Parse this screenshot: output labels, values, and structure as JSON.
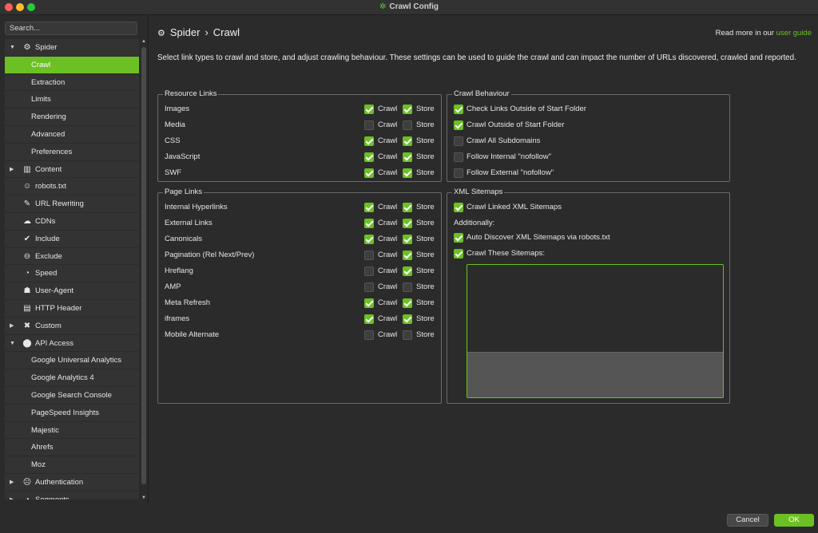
{
  "window": {
    "title": "Crawl Config",
    "logo_icon": "spider-web-icon"
  },
  "sidebar": {
    "search_placeholder": "Search...",
    "items": [
      {
        "label": "Spider",
        "icon": "⚙",
        "expanded": true,
        "level": "top"
      },
      {
        "label": "Crawl",
        "level": "child",
        "active": true
      },
      {
        "label": "Extraction",
        "level": "child"
      },
      {
        "label": "Limits",
        "level": "child"
      },
      {
        "label": "Rendering",
        "level": "child"
      },
      {
        "label": "Advanced",
        "level": "child"
      },
      {
        "label": "Preferences",
        "level": "child"
      },
      {
        "label": "Content",
        "icon": "▥",
        "expanded": false,
        "level": "top"
      },
      {
        "label": "robots.txt",
        "icon": "☺",
        "level": "top"
      },
      {
        "label": "URL Rewriting",
        "icon": "✎",
        "level": "top"
      },
      {
        "label": "CDNs",
        "icon": "☁",
        "level": "top"
      },
      {
        "label": "Include",
        "icon": "✔",
        "level": "top"
      },
      {
        "label": "Exclude",
        "icon": "⊖",
        "level": "top"
      },
      {
        "label": "Speed",
        "icon": "◔",
        "level": "top"
      },
      {
        "label": "User-Agent",
        "icon": "☗",
        "level": "top"
      },
      {
        "label": "HTTP Header",
        "icon": "▤",
        "level": "top"
      },
      {
        "label": "Custom",
        "icon": "✖",
        "expanded": false,
        "level": "top"
      },
      {
        "label": "API Access",
        "icon": "⬤",
        "expanded": true,
        "level": "top"
      },
      {
        "label": "Google Universal Analytics",
        "level": "child"
      },
      {
        "label": "Google Analytics 4",
        "level": "child"
      },
      {
        "label": "Google Search Console",
        "level": "child"
      },
      {
        "label": "PageSpeed Insights",
        "level": "child"
      },
      {
        "label": "Majestic",
        "level": "child"
      },
      {
        "label": "Ahrefs",
        "level": "child"
      },
      {
        "label": "Moz",
        "level": "child"
      },
      {
        "label": "Authentication",
        "icon": "☹",
        "expanded": false,
        "level": "top"
      },
      {
        "label": "Segments",
        "icon": "◕",
        "expanded": false,
        "level": "top"
      }
    ]
  },
  "header": {
    "breadcrumb_root": "Spider",
    "breadcrumb_separator": "›",
    "breadcrumb_current": "Crawl",
    "readmore_prefix": "Read more in our",
    "readmore_link": "user guide"
  },
  "description": "Select link types to crawl and store, and adjust crawling behaviour. These settings can be used to guide the crawl and can impact the number of URLs discovered, crawled and reported.",
  "crawl_label": "Crawl",
  "store_label": "Store",
  "resource_links": {
    "title": "Resource Links",
    "rows": [
      {
        "label": "Images",
        "crawl": true,
        "store": true
      },
      {
        "label": "Media",
        "crawl": false,
        "store": false
      },
      {
        "label": "CSS",
        "crawl": true,
        "store": true
      },
      {
        "label": "JavaScript",
        "crawl": true,
        "store": true
      },
      {
        "label": "SWF",
        "crawl": true,
        "store": true
      }
    ]
  },
  "page_links": {
    "title": "Page Links",
    "rows": [
      {
        "label": "Internal Hyperlinks",
        "crawl": true,
        "store": true
      },
      {
        "label": "External Links",
        "crawl": true,
        "store": true
      },
      {
        "label": "Canonicals",
        "crawl": true,
        "store": true
      },
      {
        "label": "Pagination (Rel Next/Prev)",
        "crawl": false,
        "store": true
      },
      {
        "label": "Hreflang",
        "crawl": false,
        "store": true
      },
      {
        "label": "AMP",
        "crawl": false,
        "store": false
      },
      {
        "label": "Meta Refresh",
        "crawl": true,
        "store": true
      },
      {
        "label": "iframes",
        "crawl": true,
        "store": true
      },
      {
        "label": "Mobile Alternate",
        "crawl": false,
        "store": false
      }
    ]
  },
  "crawl_behaviour": {
    "title": "Crawl Behaviour",
    "rows": [
      {
        "label": "Check Links Outside of Start Folder",
        "checked": true
      },
      {
        "label": "Crawl Outside of Start Folder",
        "checked": true
      },
      {
        "label": "Crawl All Subdomains",
        "checked": false
      },
      {
        "label": "Follow Internal \"nofollow\"",
        "checked": false
      },
      {
        "label": "Follow External \"nofollow\"",
        "checked": false
      }
    ]
  },
  "xml_sitemaps": {
    "title": "XML Sitemaps",
    "crawl_linked": {
      "label": "Crawl Linked XML Sitemaps",
      "checked": true
    },
    "additionally": "Additionally:",
    "auto_discover": {
      "label": "Auto Discover XML Sitemaps via robots.txt",
      "checked": true
    },
    "crawl_these": {
      "label": "Crawl These Sitemaps:",
      "checked": true
    },
    "sitemaps_value": ""
  },
  "footer": {
    "cancel_label": "Cancel",
    "ok_label": "OK"
  },
  "colors": {
    "accent": "#6cc024",
    "background": "#2b2b2b",
    "panel": "#333333"
  }
}
